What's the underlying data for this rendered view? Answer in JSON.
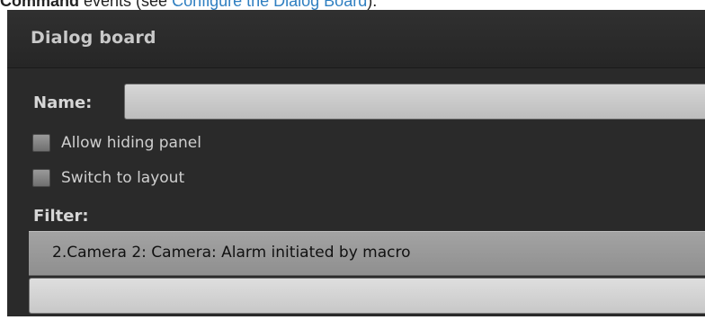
{
  "doc": {
    "bold_prefix": "Command",
    "text_before_link": " events (see ",
    "link_text": "Configure the Dialog Board",
    "text_after_link": ")."
  },
  "panel": {
    "title": "Dialog board",
    "name_label": "Name:",
    "name_value": "",
    "checkboxes": [
      {
        "label": "Allow hiding panel",
        "checked": false
      },
      {
        "label": "Switch to layout",
        "checked": false
      }
    ],
    "filter_label": "Filter:",
    "filter_items": [
      "2.Camera 2: Camera: Alarm initiated by macro"
    ],
    "filter_input_value": ""
  },
  "colors": {
    "panel_bg": "#2a2a2a",
    "link": "#2f7fc1",
    "label_text": "#d6d6d6"
  }
}
